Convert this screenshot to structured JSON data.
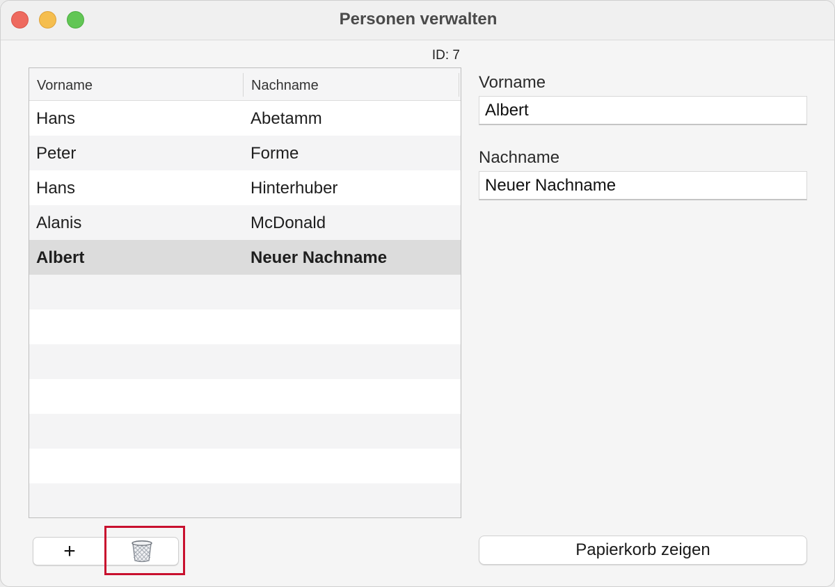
{
  "window": {
    "title": "Personen verwalten"
  },
  "record": {
    "id_label": "ID: 7"
  },
  "table": {
    "headers": [
      "Vorname",
      "Nachname"
    ],
    "rows": [
      [
        "Hans",
        "Abetamm"
      ],
      [
        "Peter",
        "Forme"
      ],
      [
        "Hans",
        "Hinterhuber"
      ],
      [
        "Alanis",
        "McDonald"
      ],
      [
        "Albert",
        "Neuer Nachname"
      ]
    ],
    "selected_index": 4
  },
  "form": {
    "vorname_label": "Vorname",
    "vorname_value": "Albert",
    "nachname_label": "Nachname",
    "nachname_value": "Neuer Nachname"
  },
  "toolbar": {
    "add_label": "+",
    "delete_icon": "trash-icon",
    "show_trash_label": "Papierkorb zeigen"
  },
  "colors": {
    "highlight": "#c8102e",
    "selected_row": "#dcdcdc"
  }
}
